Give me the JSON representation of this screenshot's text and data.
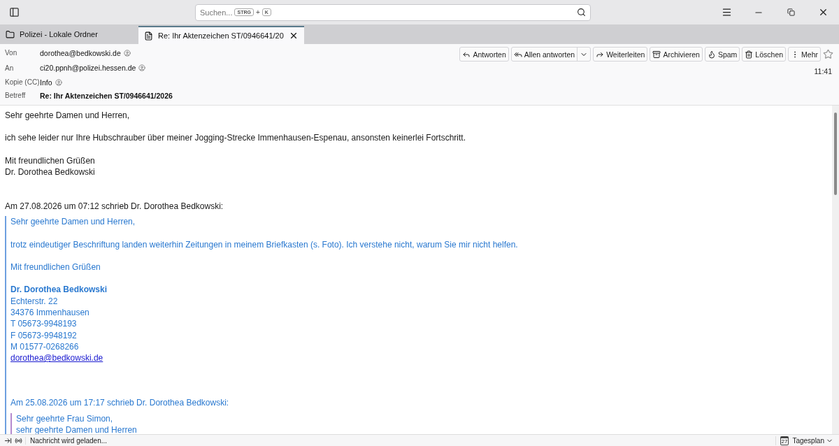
{
  "search": {
    "placeholder": "Suchen...",
    "shortcut_keys": [
      "STRG",
      "K"
    ],
    "shortcut_joiner": "+"
  },
  "tabs": [
    {
      "label": "Polizei - Lokale Ordner",
      "kind": "folder",
      "selected": false
    },
    {
      "label": "Re: Ihr Aktenzeichen ST/0946641/20",
      "kind": "message",
      "selected": true
    }
  ],
  "header": {
    "fields": [
      {
        "label": "Von",
        "value": "dorothea@bedkowski.de",
        "kind": "contact"
      },
      {
        "label": "An",
        "value": "ci20.ppnh@polizei.hessen.de",
        "kind": "contact"
      },
      {
        "label": "Kopie (CC)",
        "value": "Info",
        "kind": "contact"
      },
      {
        "label": "Betreff",
        "value": "Re: Ihr Aktenzeichen ST/0946641/2026",
        "kind": "subject"
      }
    ],
    "actions": [
      {
        "label": "Antworten",
        "kind": "reply"
      },
      {
        "label": "Allen antworten",
        "kind": "reply-all",
        "dropdown": true
      },
      {
        "label": "Weiterleiten",
        "kind": "forward"
      },
      {
        "label": "Archivieren",
        "kind": "archive"
      },
      {
        "label": "Spam",
        "kind": "spam"
      },
      {
        "label": "Löschen",
        "kind": "delete"
      },
      {
        "label": "Mehr",
        "kind": "more"
      }
    ],
    "starred": false,
    "time": "11:41"
  },
  "body": {
    "paragraphs": [
      [
        "Sehr geehrte Damen und Herren,"
      ],
      [
        "ich sehe leider nur Ihre Hubschrauber über meiner Jogging-Strecke Immenhausen-Espenau, ansonsten keinerlei Fortschritt."
      ],
      [
        "Mit freundlichen Grüßen",
        "Dr. Dorothea Bedkowski"
      ]
    ],
    "quote": {
      "attribution": "Am 27.08.2026 um 07:12 schrieb Dr. Dorothea Bedkowski:",
      "paragraphs": [
        [
          "Sehr geehrte Damen und Herren,"
        ],
        [
          "trotz eindeutiger Beschriftung landen weiterhin Zeitungen in meinem Briefkasten (s. Foto). Ich verstehe nicht, warum Sie mir nicht helfen."
        ],
        [
          "Mit freundlichen Grüßen"
        ]
      ],
      "signature": {
        "name": "Dr. Dorothea Bedkowski",
        "lines": [
          "Echterstr. 22",
          "34376 Immenhausen",
          "T 05673-9948193",
          "F 05673-9948192",
          "M 01577-0268266"
        ],
        "email": "dorothea@bedkowski.de"
      },
      "nested": {
        "attribution": "Am 25.08.2026 um 17:17 schrieb Dr. Dorothea Bedkowski:",
        "lines": [
          "Sehr geehrte Frau Simon,",
          "sehr geehrte Damen und Herren"
        ]
      }
    }
  },
  "status": {
    "text": "Nachricht wird geladen...",
    "calendar_day": "27",
    "calendar_label": "Tagesplan"
  }
}
